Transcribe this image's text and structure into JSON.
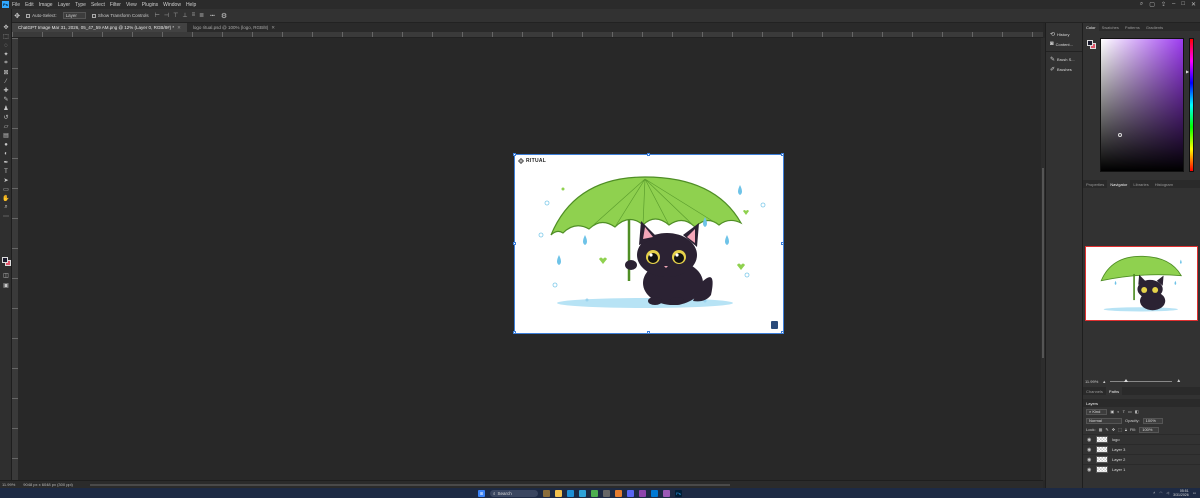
{
  "menubar": {
    "items": [
      "File",
      "Edit",
      "Image",
      "Layer",
      "Type",
      "Select",
      "Filter",
      "View",
      "Plugins",
      "Window",
      "Help"
    ]
  },
  "options": {
    "auto_select": "Auto-Select:",
    "target": "Layer",
    "transform": "Show Transform Controls",
    "more": "•••"
  },
  "tabs": [
    {
      "label": "ChatGPT Image Mar 31, 2026, 05_47_59 AM.png @ 12% (Layer 0, RGB/8#) *"
    },
    {
      "label": "logo ritual.psd @ 100% (logo, RGB/8)"
    }
  ],
  "canvas": {
    "brand": "RITUAL"
  },
  "status": {
    "zoom": "11.99%",
    "info": "9048 px x 6048 px (300 ppi)"
  },
  "dock": {
    "items": [
      "History",
      "Content...",
      "Brush S...",
      "Brushes"
    ]
  },
  "color_panel": {
    "tabs": [
      "Color",
      "Swatches",
      "Patterns",
      "Gradients"
    ],
    "fg_color": "#1b1b2e",
    "bg_color": "#e0566b"
  },
  "navigator": {
    "tabs": [
      "Properties",
      "Navigator",
      "Libraries",
      "Histogram"
    ],
    "zoom": "11.99%"
  },
  "layers": {
    "header_tabs": [
      "Channels",
      "Paths"
    ],
    "title": "Layers",
    "kind": "Kind",
    "blend": "Normal",
    "opacity_label": "Opacity:",
    "opacity": "100%",
    "lock_label": "Lock:",
    "fill_label": "Fill:",
    "fill": "100%",
    "rows": [
      {
        "name": "logo"
      },
      {
        "name": "Layer 3"
      },
      {
        "name": "Layer 2"
      },
      {
        "name": "Layer 1"
      }
    ]
  },
  "taskbar": {
    "search": "Search",
    "time": "05:51",
    "date": "3/31/2026"
  }
}
